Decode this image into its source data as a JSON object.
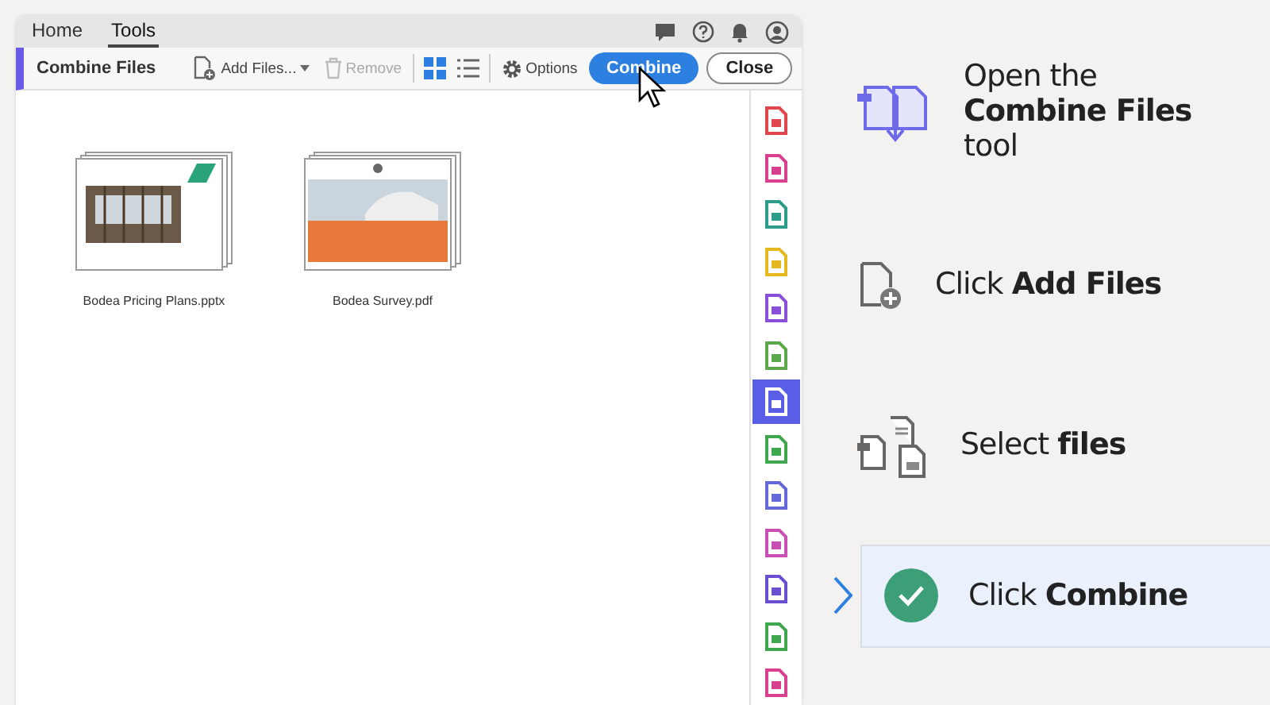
{
  "tabs": [
    {
      "label": "Home",
      "selected": false
    },
    {
      "label": "Tools",
      "selected": true
    }
  ],
  "toolbar": {
    "title": "Combine Files",
    "add_files": "Add Files...",
    "remove": {
      "label": "Remove",
      "disabled": true
    },
    "view_modes": [
      {
        "kind": "grid",
        "selected": true
      },
      {
        "kind": "list",
        "selected": false
      }
    ],
    "options": "Options",
    "combine": "Combine",
    "close": "Close"
  },
  "files": [
    {
      "name": "Bodea Pricing Plans.pptx",
      "kind": "slides"
    },
    {
      "name": "Bodea Survey.pdf",
      "kind": "report"
    }
  ],
  "tools": [
    {
      "color": "#e0474c",
      "selected": false
    },
    {
      "color": "#d9408f",
      "selected": false
    },
    {
      "color": "#2e9c8a",
      "selected": false
    },
    {
      "color": "#e5b820",
      "selected": false
    },
    {
      "color": "#8a4fd8",
      "selected": false
    },
    {
      "color": "#5aa84a",
      "selected": false
    },
    {
      "color": "#5a5ee6",
      "selected": true
    },
    {
      "color": "#3fa84f",
      "selected": false
    },
    {
      "color": "#6468d8",
      "selected": false
    },
    {
      "color": "#c94fb5",
      "selected": false
    },
    {
      "color": "#6a4fd0",
      "selected": false
    },
    {
      "color": "#3fa84f",
      "selected": false
    },
    {
      "color": "#d9408f",
      "selected": false
    }
  ],
  "steps": [
    {
      "kind": "combine",
      "text": "Open the **Combine Files** tool",
      "selected": false
    },
    {
      "kind": "add",
      "text": "Click **Add Files**",
      "selected": false
    },
    {
      "kind": "select",
      "text": "Select **files**",
      "selected": false
    },
    {
      "kind": "done",
      "text": "Click **Combine**",
      "selected": true
    }
  ]
}
